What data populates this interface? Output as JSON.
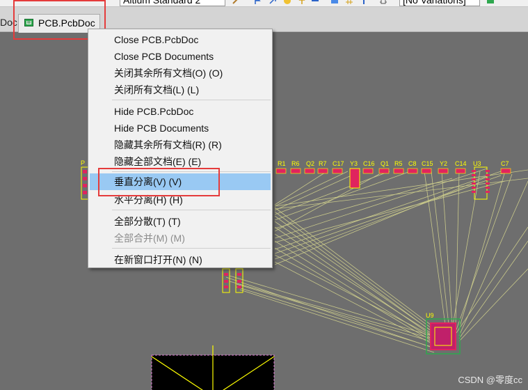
{
  "toolbar": {
    "project_combo": "Altium Standard 2",
    "variant_combo": "[No Variations]"
  },
  "tabs": {
    "previous_tab_fragment": "Doc",
    "active_tab": "PCB.PcbDoc"
  },
  "context_menu": {
    "items": [
      {
        "label": "Close PCB.PcbDoc",
        "enabled": true
      },
      {
        "label": "Close PCB Documents",
        "enabled": true
      },
      {
        "label": "关闭其余所有文档(O) (O)",
        "enabled": true
      },
      {
        "label": "关闭所有文档(L) (L)",
        "enabled": true
      },
      {
        "label": "Hide PCB.PcbDoc",
        "enabled": true
      },
      {
        "label": "Hide PCB Documents",
        "enabled": true
      },
      {
        "label": "隐藏其余所有文档(R) (R)",
        "enabled": true
      },
      {
        "label": "隐藏全部文档(E) (E)",
        "enabled": true
      },
      {
        "label": "垂直分离(V) (V)",
        "enabled": true,
        "highlighted": true
      },
      {
        "label": "水平分离(H) (H)",
        "enabled": true
      },
      {
        "label": "全部分散(T) (T)",
        "enabled": true
      },
      {
        "label": "全部合并(M) (M)",
        "enabled": false
      },
      {
        "label": "在新窗口打开(N) (N)",
        "enabled": true
      }
    ]
  },
  "pcb": {
    "designators": [
      "R1",
      "R6",
      "Q2",
      "R7",
      "C17",
      "Y3",
      "C16",
      "Q1",
      "R5",
      "C8",
      "C15",
      "Y2",
      "C14",
      "U3",
      "C7",
      "U9"
    ],
    "left_header": "P"
  },
  "colors": {
    "canvas": "#6e6e6e",
    "ratsnest": "#c9c98a",
    "silkscreen": "#ffff00",
    "pad": "#e0245e",
    "highlight": "#99c9f3",
    "annotation_red": "#e53b3b"
  },
  "watermark": "CSDN @零度cc"
}
